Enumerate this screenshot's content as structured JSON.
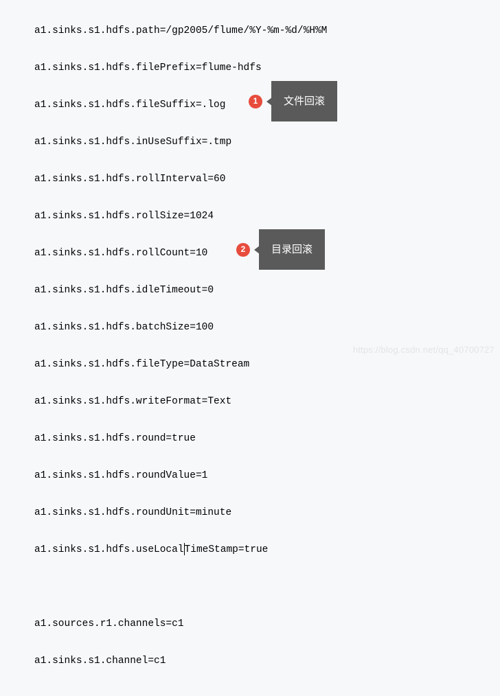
{
  "code": {
    "l1": "a1.sinks.s1.hdfs.path=/gp2005/flume/%Y-%m-%d/%H%M",
    "l2": "a1.sinks.s1.hdfs.filePrefix=flume-hdfs",
    "l3": "a1.sinks.s1.hdfs.fileSuffix=.log",
    "l4": "a1.sinks.s1.hdfs.inUseSuffix=.tmp",
    "l5": "a1.sinks.s1.hdfs.rollInterval=60",
    "l6": "a1.sinks.s1.hdfs.rollSize=1024",
    "l7": "a1.sinks.s1.hdfs.rollCount=10",
    "l8": "a1.sinks.s1.hdfs.idleTimeout=0",
    "l9": "a1.sinks.s1.hdfs.batchSize=100",
    "l10": "a1.sinks.s1.hdfs.fileType=DataStream",
    "l11": "a1.sinks.s1.hdfs.writeFormat=Text",
    "l12": "a1.sinks.s1.hdfs.round=true",
    "l13": "a1.sinks.s1.hdfs.roundValue=1",
    "l14": "a1.sinks.s1.hdfs.roundUnit=minute",
    "l15a": "a1.sinks.s1.hdfs.useLocal",
    "l15b": "TimeStamp=true",
    "l16": "a1.sources.r1.channels=c1",
    "l17": "a1.sinks.s1.channel=c1"
  },
  "annotations": {
    "a1": {
      "num": "1",
      "label": "文件回滚"
    },
    "a2": {
      "num": "2",
      "label": "目录回滚"
    }
  },
  "watermark": "https://blog.csdn.net/qq_40700727"
}
